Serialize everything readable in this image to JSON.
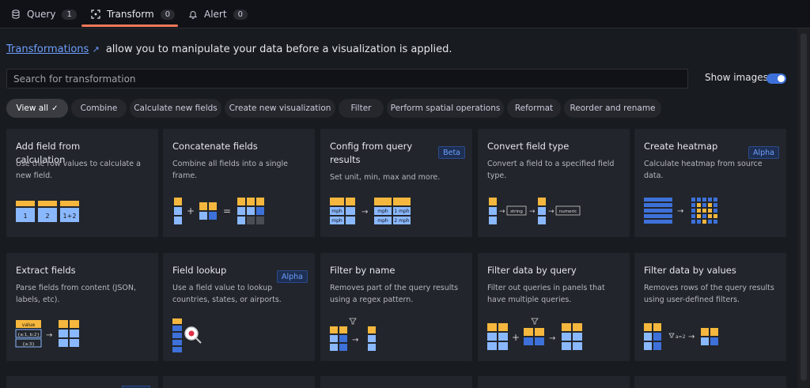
{
  "tabs": [
    {
      "label": "Query",
      "count": "1",
      "icon": "database-icon"
    },
    {
      "label": "Transform",
      "count": "0",
      "icon": "transform-icon"
    },
    {
      "label": "Alert",
      "count": "0",
      "icon": "bell-icon"
    }
  ],
  "intro": {
    "link": "Transformations",
    "text": "allow you to manipulate your data before a visualization is applied."
  },
  "search": {
    "placeholder": "Search for transformation"
  },
  "show_images": {
    "label": "Show images",
    "enabled": true
  },
  "filters": [
    "View all",
    "Combine",
    "Calculate new fields",
    "Create new visualization",
    "Filter",
    "Perform spatial operations",
    "Reformat",
    "Reorder and rename"
  ],
  "selected_filter": "View all",
  "cards": [
    {
      "title": "Add field from calculation",
      "desc": "Use the row values to calculate a new field.",
      "badge": ""
    },
    {
      "title": "Concatenate fields",
      "desc": "Combine all fields into a single frame.",
      "badge": ""
    },
    {
      "title": "Config from query results",
      "desc": "Set unit, min, max and more.",
      "badge": "Beta"
    },
    {
      "title": "Convert field type",
      "desc": "Convert a field to a specified field type.",
      "badge": ""
    },
    {
      "title": "Create heatmap",
      "desc": "Calculate heatmap from source data.",
      "badge": "Alpha"
    },
    {
      "title": "Extract fields",
      "desc": "Parse fields from content (JSON, labels, etc).",
      "badge": ""
    },
    {
      "title": "Field lookup",
      "desc": "Use a field value to lookup countries, states, or airports.",
      "badge": "Alpha"
    },
    {
      "title": "Filter by name",
      "desc": "Removes part of the query results using a regex pattern.",
      "badge": ""
    },
    {
      "title": "Filter data by query",
      "desc": "Filter out queries in panels that have multiple queries.",
      "badge": ""
    },
    {
      "title": "Filter data by values",
      "desc": "Removes rows of the query results using user-defined filters.",
      "badge": ""
    }
  ],
  "illustration_text": {
    "add_field": [
      "1",
      "2",
      "1+2"
    ],
    "config_mph": "mph",
    "config_1mph": "1 mph",
    "config_2mph": "2 mph",
    "convert_string": "string",
    "convert_numeric": "numeric",
    "extract_value": "value",
    "extract_obj1": "{a:1, b:2}",
    "extract_obj2": "{a:3}",
    "filter_values_cond": "a=2"
  },
  "colors": {
    "accent": "#f2795a",
    "link": "#6e9fff",
    "yellow": "#f5b73d",
    "blue_cell": "#8ab8ff",
    "toggle": "#3d71d9"
  }
}
